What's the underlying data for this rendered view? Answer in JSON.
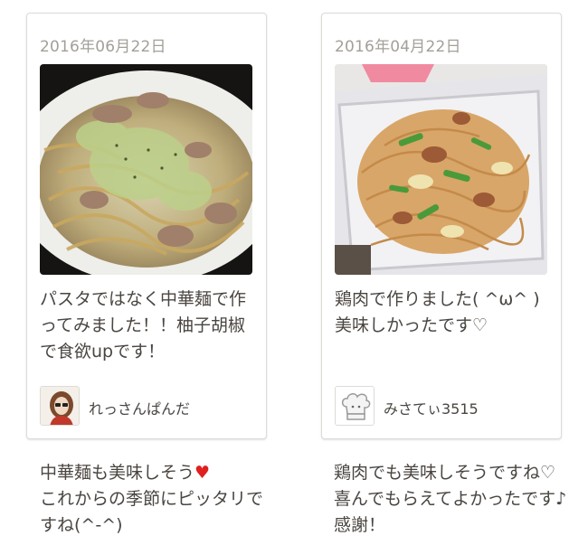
{
  "cards": [
    {
      "date": "2016年06月22日",
      "description": "パスタではなく中華麺で作ってみました！！柚子胡椒で食欲upです！",
      "author": "れっさんぱんだ",
      "reply": "中華麺も美味しそう",
      "reply_heart": "♥",
      "reply_tail": "これからの季節にピッタリですね(^-^)"
    },
    {
      "date": "2016年04月22日",
      "description": "鶏肉で作りました( ^ω^ )美味しかったです♡",
      "author": "みさてぃ3515",
      "reply": "鶏肉でも美味しそうですね♡喜んでもらえてよかったです♪感謝！"
    }
  ],
  "colors": {
    "accent_heart": "#e0201f",
    "date_text": "#a39f98",
    "body_text": "#4a4540"
  },
  "icons": [
    "chef-hat-icon",
    "user-avatar-photo"
  ]
}
